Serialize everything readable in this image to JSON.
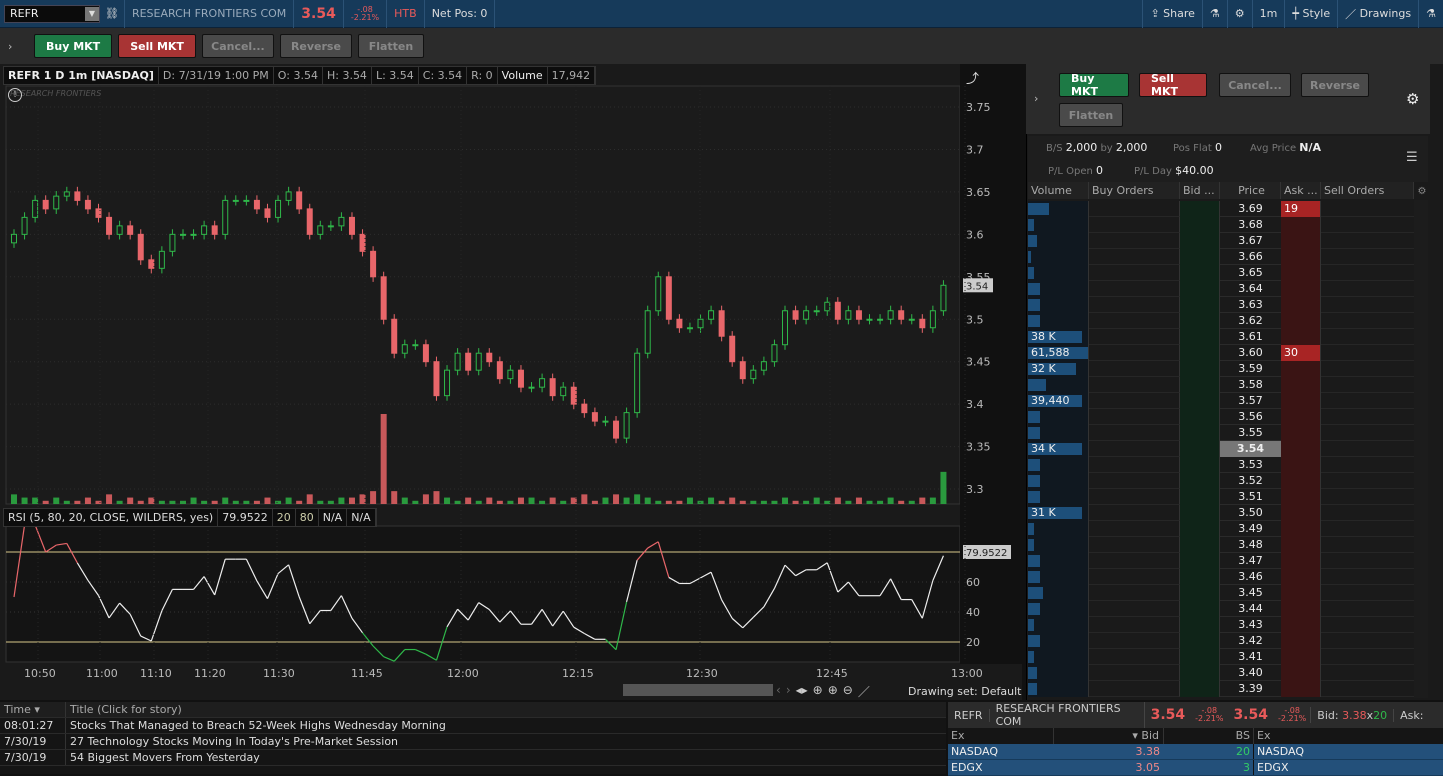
{
  "topbar": {
    "symbol": "REFR",
    "company": "RESEARCH FRONTIERS COM",
    "last": "3.54",
    "chg": "-.08",
    "chg_pct": "-2.21%",
    "htb": "HTB",
    "net_pos": "Net Pos: 0",
    "share": "Share",
    "interval": "1m",
    "style": "Style",
    "drawings": "Drawings"
  },
  "orders": {
    "buy": "Buy MKT",
    "sell": "Sell MKT",
    "cancel": "Cancel...",
    "reverse": "Reverse",
    "flatten": "Flatten"
  },
  "chart": {
    "header": {
      "title": "REFR 1 D 1m [NASDAQ]",
      "date": "D: 7/31/19 1:00 PM",
      "open": "O: 3.54",
      "high": "H: 3.54",
      "low": "L: 3.54",
      "close": "C: 3.54",
      "range": "R: 0",
      "volume_label": "Volume",
      "volume": "17,942"
    },
    "watermark": "RESEARCH FRONTIERS",
    "price_ticks": [
      "3.75",
      "3.7",
      "3.65",
      "3.6",
      "3.55",
      "3.5",
      "3.45",
      "3.4",
      "3.35",
      "3.3"
    ],
    "last_price_label": "3.54",
    "time_ticks": [
      "10:50",
      "11:00",
      "11:10",
      "11:20",
      "11:30",
      "11:45",
      "12:00",
      "12:15",
      "12:30",
      "12:45",
      "13:00"
    ],
    "rsi": {
      "title": "RSI (5, 80, 20, CLOSE, WILDERS, yes)",
      "value": "79.9522",
      "low": "20",
      "high": "80",
      "up": "N/A",
      "down": "N/A",
      "ticks": [
        "60",
        "40",
        "20"
      ],
      "label": "79.9522"
    },
    "drawing_set": "Drawing set: Default"
  },
  "chart_data": {
    "type": "candlestick",
    "ylim": [
      3.28,
      3.77
    ],
    "closes": [
      3.6,
      3.62,
      3.64,
      3.63,
      3.645,
      3.65,
      3.64,
      3.63,
      3.62,
      3.6,
      3.61,
      3.6,
      3.57,
      3.56,
      3.58,
      3.6,
      3.6,
      3.6,
      3.61,
      3.6,
      3.64,
      3.64,
      3.64,
      3.63,
      3.62,
      3.64,
      3.65,
      3.63,
      3.6,
      3.61,
      3.61,
      3.62,
      3.6,
      3.58,
      3.55,
      3.5,
      3.46,
      3.47,
      3.47,
      3.45,
      3.41,
      3.44,
      3.46,
      3.44,
      3.46,
      3.45,
      3.43,
      3.44,
      3.42,
      3.42,
      3.43,
      3.41,
      3.42,
      3.4,
      3.39,
      3.38,
      3.38,
      3.36,
      3.39,
      3.46,
      3.51,
      3.55,
      3.5,
      3.49,
      3.49,
      3.5,
      3.51,
      3.48,
      3.45,
      3.43,
      3.44,
      3.45,
      3.47,
      3.51,
      3.5,
      3.51,
      3.51,
      3.52,
      3.5,
      3.51,
      3.5,
      3.5,
      3.5,
      3.51,
      3.5,
      3.5,
      3.49,
      3.51,
      3.54
    ],
    "volumes": [
      3,
      2,
      2,
      1,
      2,
      1,
      1,
      2,
      1,
      3,
      1,
      2,
      1,
      2,
      1,
      1,
      1,
      2,
      1,
      1,
      2,
      1,
      1,
      1,
      2,
      1,
      2,
      1,
      3,
      1,
      1,
      2,
      2,
      3,
      4,
      28,
      4,
      2,
      1,
      3,
      4,
      2,
      1,
      2,
      1,
      2,
      1,
      1,
      2,
      2,
      1,
      2,
      1,
      2,
      3,
      1,
      2,
      3,
      2,
      3,
      2,
      1,
      1,
      1,
      2,
      1,
      2,
      1,
      2,
      1,
      1,
      1,
      1,
      2,
      1,
      1,
      2,
      1,
      2,
      1,
      2,
      1,
      1,
      2,
      1,
      1,
      2,
      2,
      10
    ]
  },
  "book": {
    "info": {
      "bs_label": "B/S",
      "bs_buy": "2,000",
      "by": "by",
      "bs_sell": "2,000",
      "pos_flat_label": "Pos Flat",
      "pos_flat": "0",
      "avg_label": "Avg Price",
      "avg": "N/A",
      "plopen_label": "P/L Open",
      "plopen": "0",
      "plday_label": "P/L Day",
      "plday": "$40.00"
    },
    "headers": [
      "Volume",
      "Buy Orders",
      "Bid ...",
      "Price",
      "Ask ...",
      "Sell Orders"
    ],
    "prices": [
      "3.69",
      "3.68",
      "3.67",
      "3.66",
      "3.65",
      "3.64",
      "3.63",
      "3.62",
      "3.61",
      "3.60",
      "3.59",
      "3.58",
      "3.57",
      "3.56",
      "3.55",
      "3.54",
      "3.53",
      "3.52",
      "3.51",
      "3.50",
      "3.49",
      "3.48",
      "3.47",
      "3.46",
      "3.45",
      "3.44",
      "3.43",
      "3.42",
      "3.41",
      "3.40",
      "3.39"
    ],
    "volume_labels": {
      "3.61": "38 K",
      "3.60": "61,588",
      "3.59": "32 K",
      "3.57": "39,440",
      "3.54": "34 K",
      "3.50": "31 K"
    },
    "volume_fraction": [
      0.35,
      0.1,
      0.15,
      0.05,
      0.1,
      0.2,
      0.2,
      0.2,
      0.9,
      1,
      0.8,
      0.3,
      0.9,
      0.2,
      0.2,
      0.9,
      0.2,
      0.2,
      0.2,
      0.9,
      0.1,
      0.1,
      0.2,
      0.2,
      0.25,
      0.2,
      0.1,
      0.2,
      0.1,
      0.15,
      0.15
    ],
    "asks": {
      "3.69": "19",
      "3.60": "30"
    },
    "current": "3.54"
  },
  "news": {
    "headers": [
      "Time",
      "Title (Click for story)"
    ],
    "rows": [
      [
        "08:01:27",
        "Stocks That Managed to Breach 52-Week Highs Wednesday Morning"
      ],
      [
        "7/30/19",
        "27 Technology Stocks Moving In Today's Pre-Market Session"
      ],
      [
        "7/30/19",
        "54 Biggest Movers From Yesterday"
      ]
    ]
  },
  "level2": {
    "symbol": "REFR",
    "company": "RESEARCH FRONTIERS COM",
    "last": "3.54",
    "chg": "-.08",
    "chg_pct": "-2.21%",
    "last2": "3.54",
    "bid_label": "Bid:",
    "bid": "3.38",
    "x": "x",
    "bid_size": "20",
    "ask_label": "Ask:",
    "headers": [
      "Ex",
      "Bid",
      "BS",
      "Ex"
    ],
    "rows": [
      [
        "NASDAQ",
        "3.38",
        "20",
        "NASDAQ"
      ],
      [
        "EDGX",
        "3.05",
        "3",
        "EDGX"
      ]
    ]
  }
}
